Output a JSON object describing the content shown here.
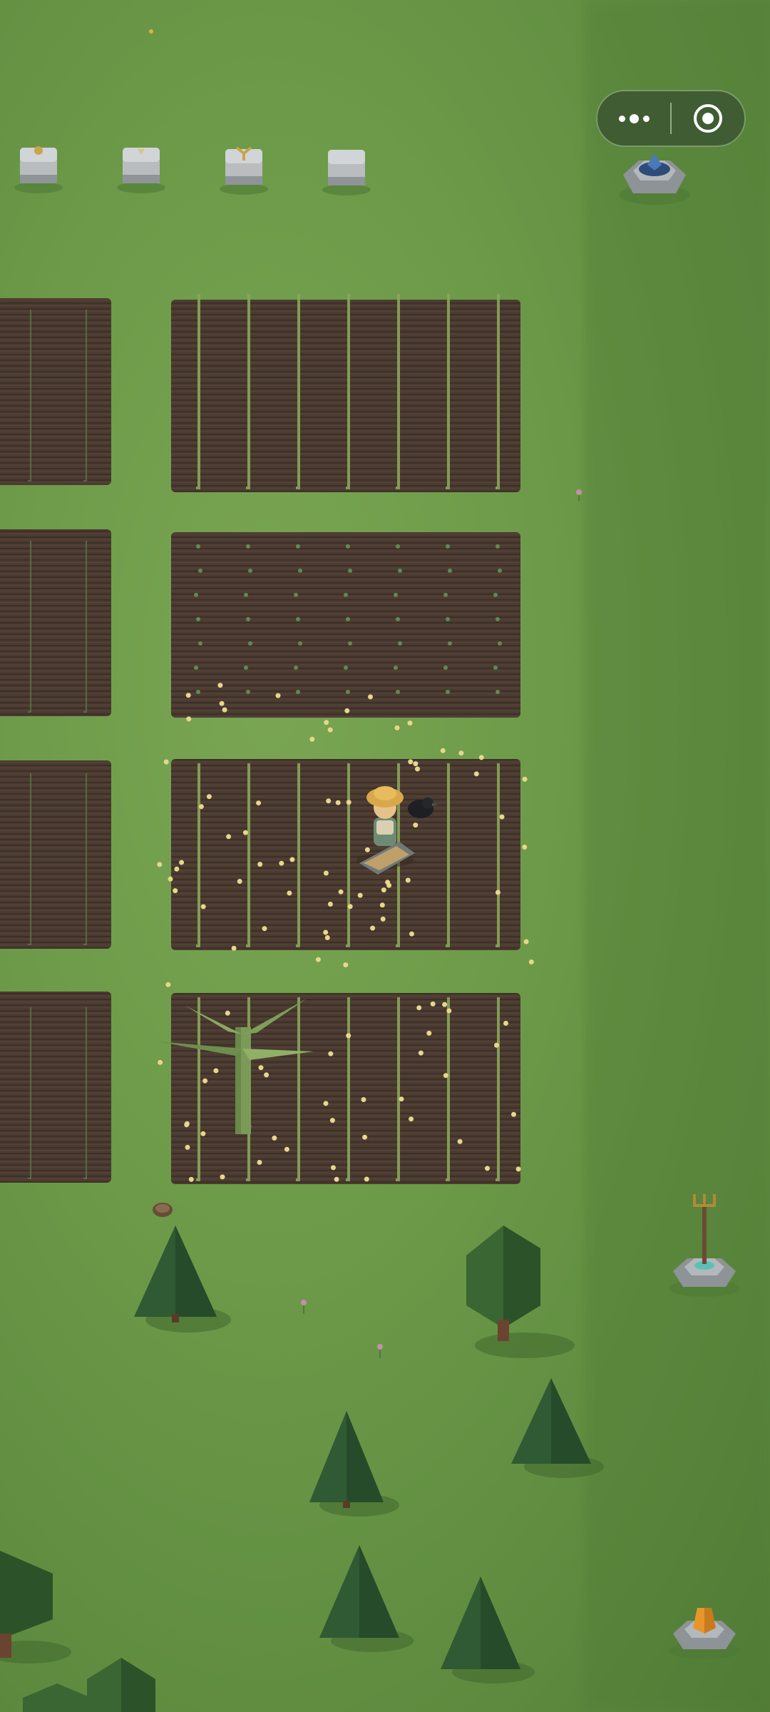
{
  "game": {
    "view": "farm-field-top-down",
    "hud": {
      "menu_icon": "more-dots-icon",
      "capture_icon": "target-circle-icon"
    },
    "colors": {
      "grass": "#6c9a48",
      "soil": "#4a3a30",
      "crop": "#8aa65a",
      "tree_dark": "#2f5a33",
      "stone": "#9a9fa3"
    },
    "plots": [
      {
        "row": 1,
        "col": 1,
        "crop": "sprouts"
      },
      {
        "row": 1,
        "col": 2,
        "crop": "tall-grain"
      },
      {
        "row": 2,
        "col": 1,
        "crop": "sprouts"
      },
      {
        "row": 2,
        "col": 2,
        "crop": "seedlings"
      },
      {
        "row": 3,
        "col": 1,
        "crop": "sprouts"
      },
      {
        "row": 3,
        "col": 2,
        "crop": "ripening-grain"
      },
      {
        "row": 4,
        "col": 1,
        "crop": "sprouts"
      },
      {
        "row": 4,
        "col": 2,
        "crop": "ripe-grain"
      }
    ],
    "player": {
      "icon": "farmer-character-icon",
      "companion_icon": "black-bird-icon"
    },
    "stations": [
      "stone-pedestal-icon",
      "stone-pedestal-icon",
      "stone-pedestal-icon",
      "stone-pedestal-icon",
      "crystal-fountain-icon",
      "pitchfork-shrine-icon",
      "orange-gem-shrine-icon"
    ]
  }
}
